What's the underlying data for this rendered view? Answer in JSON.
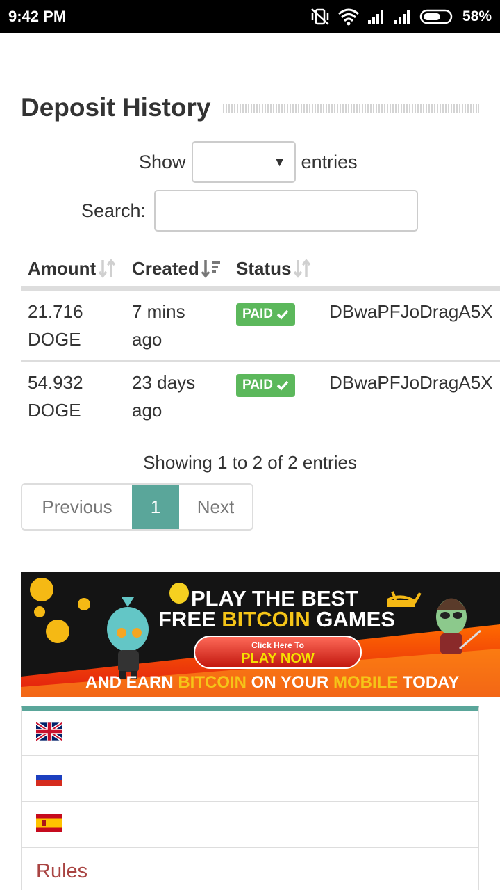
{
  "status_bar": {
    "time": "9:42 PM",
    "battery": "58%"
  },
  "page": {
    "title": "Deposit History"
  },
  "controls": {
    "show_label": "Show",
    "entries_label": "entries",
    "search_label": "Search:",
    "select_value": "",
    "search_value": ""
  },
  "table": {
    "headers": [
      "Amount",
      "Created",
      "Status"
    ],
    "rows": [
      {
        "amount": "21.716",
        "currency": "DOGE",
        "created_1": "7 mins",
        "created_2": "ago",
        "status": "PAID",
        "address": "DBwaPFJoDragA5X"
      },
      {
        "amount": "54.932",
        "currency": "DOGE",
        "created_1": "23 days",
        "created_2": "ago",
        "status": "PAID",
        "address": "DBwaPFJoDragA5X"
      }
    ]
  },
  "footer_info": "Showing 1 to 2 of 2 entries",
  "pagination": {
    "previous": "Previous",
    "current": "1",
    "next": "Next"
  },
  "banner": {
    "line1": "PLAY THE BEST",
    "line2a": "FREE ",
    "line2b": "BITCOIN",
    "line2c": " GAMES",
    "button_small": "Click Here To",
    "button_big": "PLAY NOW",
    "line3a": "AND EARN ",
    "line3b": "BITCOIN",
    "line3c": " ON YOUR ",
    "line3d": "MOBILE",
    "line3e": " TODAY"
  },
  "languages": [
    "english-flag-icon",
    "russian-flag-icon",
    "spanish-flag-icon"
  ],
  "menu": {
    "rules": "Rules"
  },
  "colors": {
    "accent": "#5aa69a",
    "paid": "#5cb85c",
    "rules": "#a94442"
  }
}
